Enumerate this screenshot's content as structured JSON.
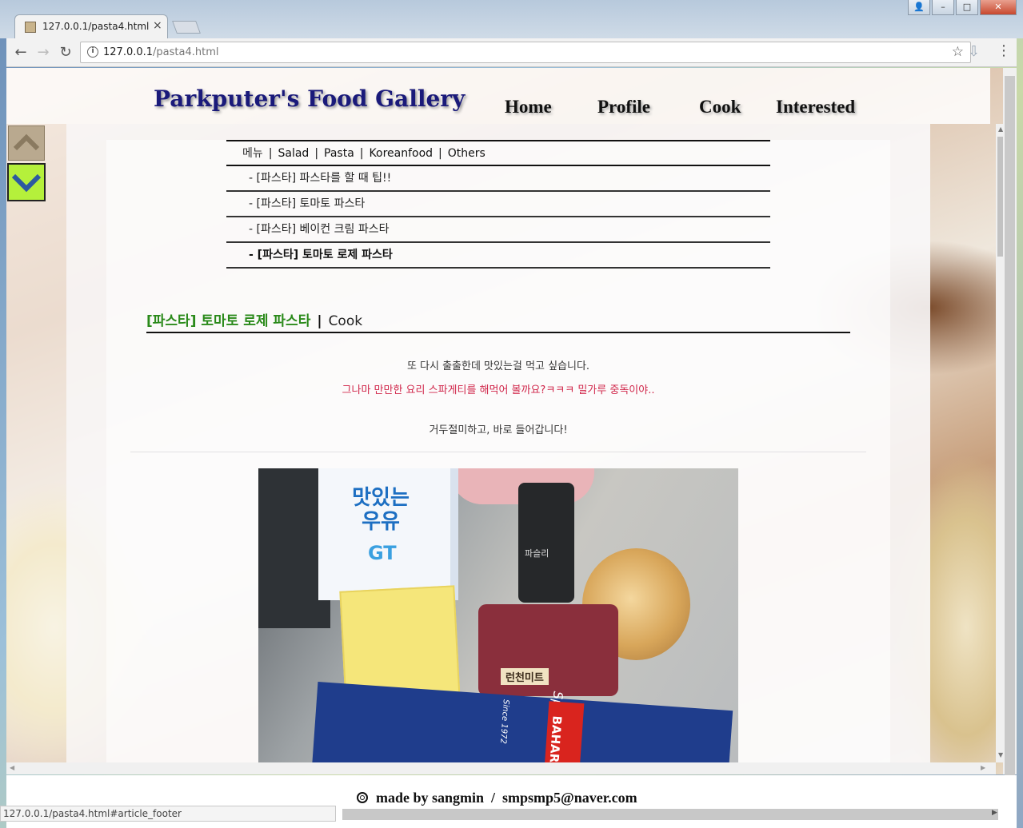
{
  "browser": {
    "tab_title": "127.0.0.1/pasta4.html",
    "tab_close": "×",
    "url_host": "127.0.0.1",
    "url_path": "/pasta4.html",
    "status_text": "127.0.0.1/pasta4.html#article_footer",
    "icons": {
      "back": "←",
      "forward": "→",
      "reload": "↻",
      "info": "i",
      "star": "☆",
      "download": "⇩",
      "menu": "⋮",
      "user": "👤",
      "minimize": "–",
      "maximize": "□",
      "close": "✕"
    }
  },
  "site": {
    "title": "Parkputer's Food Gallery",
    "nav": [
      "Home",
      "Profile",
      "Cook",
      "Interested"
    ]
  },
  "menu": {
    "head": [
      "메뉴",
      "Salad",
      "Pasta",
      "Koreanfood",
      "Others"
    ],
    "separator": "|",
    "items": [
      "- [파스타] 파스타를 할 때 팁!!",
      "- [파스타] 토마토 파스타",
      "- [파스타] 베이컨 크림 파스타",
      "- [파스타] 토마토 로제 파스타"
    ]
  },
  "article": {
    "category_title": "[파스타] 토마토 로제 파스타",
    "separator": "|",
    "section": "Cook",
    "lines": [
      "또 다시 출출한데 맛있는걸 먹고 싶습니다.",
      "그나마 만만한 요리 스파게티를 해먹어 볼까요?ㅋㅋㅋ 밀가루 중독이야..",
      "거두절미하고, 바로 들어갑니다!"
    ],
    "photo_labels": {
      "milk_brand": "맛있는 우유",
      "milk_sub": "GT",
      "jar_label": "파슬리",
      "can_label": "런천미트",
      "pasta_brand": "BAHAR",
      "pasta_type": "Spaghetti",
      "pasta_since": "Since 1972"
    }
  },
  "footer": {
    "text": "made by sangmin  /  smpsmp5@naver.com"
  },
  "colors": {
    "title_blue": "#1a1a7a",
    "category_green": "#2a8a1a",
    "highlight_red": "#d0264a",
    "down_button_green": "#b5f03b"
  }
}
